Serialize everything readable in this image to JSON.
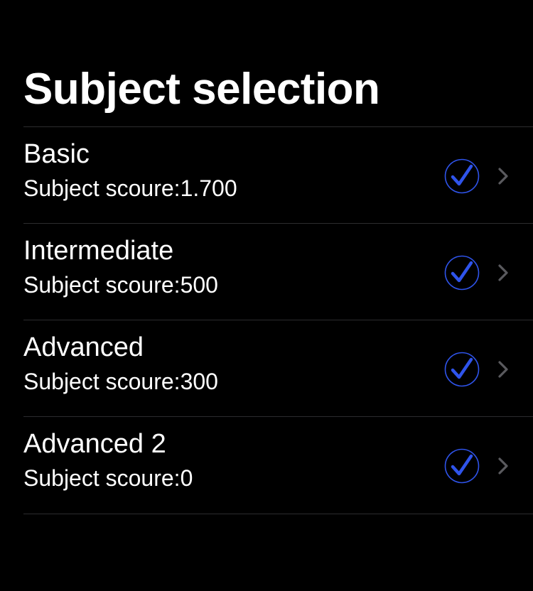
{
  "page": {
    "title": "Subject selection"
  },
  "subjects": [
    {
      "title": "Basic",
      "subtitle": "Subject scoure:1.700",
      "selected": true
    },
    {
      "title": "Intermediate",
      "subtitle": "Subject scoure:500",
      "selected": true
    },
    {
      "title": "Advanced",
      "subtitle": "Subject scoure:300",
      "selected": true
    },
    {
      "title": "Advanced 2",
      "subtitle": "Subject scoure:0",
      "selected": true
    }
  ],
  "colors": {
    "background": "#000000",
    "text": "#ffffff",
    "accent": "#2f54eb",
    "separator": "#2c2c2e",
    "chevron": "#5a5a5e"
  },
  "icons": {
    "selected": "checkmark-circle-icon",
    "disclosure": "chevron-right-icon"
  }
}
